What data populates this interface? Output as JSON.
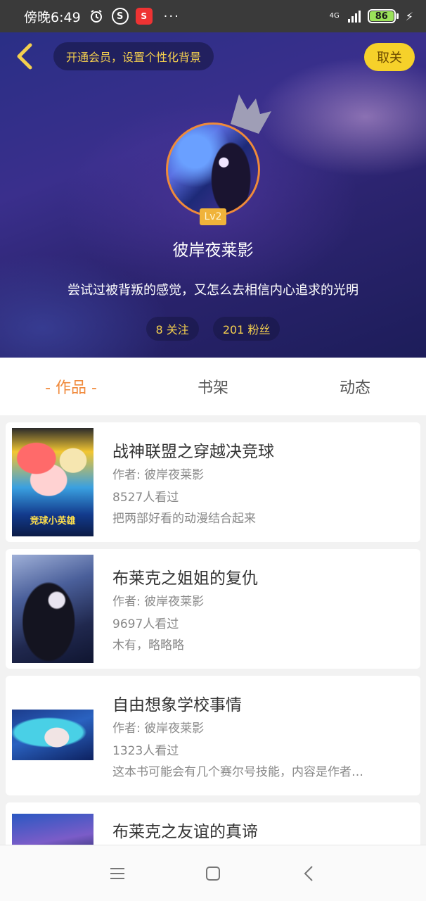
{
  "status_bar": {
    "time": "傍晚6:49",
    "icons": [
      "alarm-icon",
      "s-icon",
      "app-icon"
    ],
    "app_icon_text": "S",
    "s_icon_text": "S",
    "more": "···",
    "network": "4G",
    "battery": "86"
  },
  "header": {
    "vip_prompt": "开通会员，设置个性化背景",
    "cancel_label": "取关",
    "level": "Lv2",
    "username": "彼岸夜莱影",
    "bio": "尝试过被背叛的感觉，又怎么去相信内心追求的光明",
    "following": "8 关注",
    "followers": "201 粉丝"
  },
  "tabs": [
    {
      "label": "- 作品 -",
      "active": true
    },
    {
      "label": "书架",
      "active": false
    },
    {
      "label": "动态",
      "active": false
    }
  ],
  "works": [
    {
      "title": "战神联盟之穿越决竞球",
      "author": "作者: 彼岸夜莱影",
      "views": "8527人看过",
      "description": "把两部好看的动漫结合起来",
      "cover_text": "竞球小英雄"
    },
    {
      "title": "布莱克之姐姐的复仇",
      "author": "作者: 彼岸夜莱影",
      "views": "9697人看过",
      "description": "木有，略略略"
    },
    {
      "title": "自由想象学校事情",
      "author": "作者: 彼岸夜莱影",
      "views": "1323人看过",
      "description": "这本书可能会有几个赛尔号技能，内容是作者…"
    },
    {
      "title": "布莱克之友谊的真谛"
    }
  ],
  "colors": {
    "accent_orange": "#f08a3c",
    "gold": "#f4cf4e",
    "cancel_yellow": "#f6d12a"
  }
}
